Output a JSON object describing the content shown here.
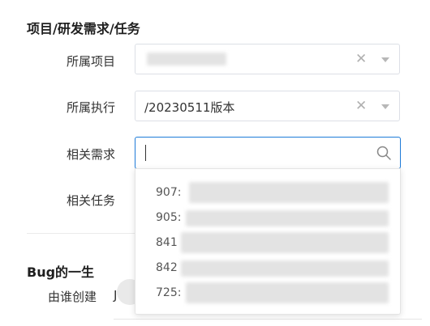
{
  "section_project": {
    "title": "项目/研发需求/任务"
  },
  "fields": {
    "project": {
      "label": "所属项目",
      "value": ""
    },
    "execution": {
      "label": "所属执行",
      "value": "/20230511版本"
    },
    "requirement": {
      "label": "相关需求",
      "placeholder": ""
    },
    "task": {
      "label": "相关任务"
    }
  },
  "dropdown": {
    "items": [
      {
        "id": "907:"
      },
      {
        "id": "905:"
      },
      {
        "id": "841"
      },
      {
        "id": "842"
      },
      {
        "id": "725:"
      }
    ]
  },
  "section_lifecycle": {
    "title": "Bug的一生"
  },
  "created_by": {
    "label": "由谁创建",
    "value": "J"
  },
  "icons": {
    "clear": "close-icon",
    "dropdown": "chevron-down-icon",
    "search": "search-icon"
  },
  "colors": {
    "accent": "#1e7bd8",
    "border": "#dcdfe6",
    "placeholder_blur": "#e3e3e3"
  }
}
